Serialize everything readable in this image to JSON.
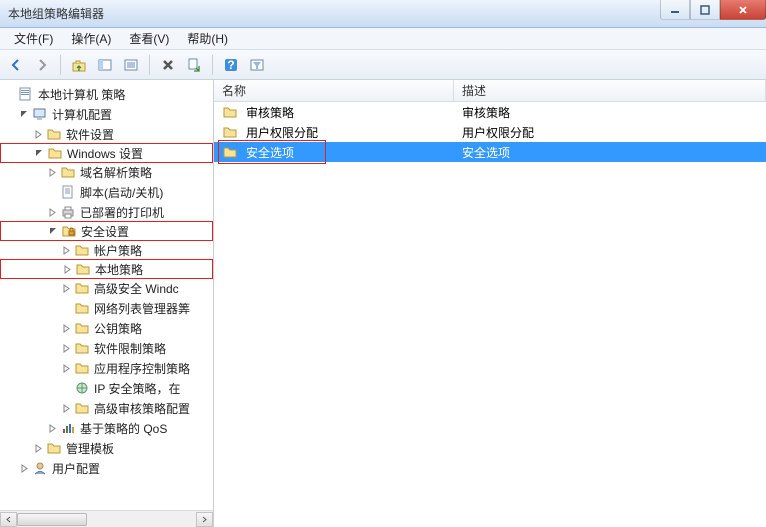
{
  "window": {
    "title": "本地组策略编辑器"
  },
  "menu": {
    "file": "文件(F)",
    "action": "操作(A)",
    "view": "查看(V)",
    "help": "帮助(H)"
  },
  "tree": {
    "root": "本地计算机 策略",
    "computer_config": "计算机配置",
    "software_settings": "软件设置",
    "windows_settings": "Windows 设置",
    "name_resolution": "域名解析策略",
    "scripts": "脚本(启动/关机)",
    "deployed_printers": "已部署的打印机",
    "security_settings": "安全设置",
    "account_policies": "帐户策略",
    "local_policies": "本地策略",
    "adv_security": "高级安全 Windc",
    "network_list": "网络列表管理器筭",
    "public_key": "公钥策略",
    "software_restriction": "软件限制策略",
    "app_control": "应用程序控制策略",
    "ip_security": "IP 安全策略，在",
    "adv_audit": "高级审核策略配置",
    "qos": "基于策略的 QoS",
    "admin_templates": "管理模板",
    "user_config": "用户配置"
  },
  "list": {
    "columns": {
      "name": "名称",
      "description": "描述"
    },
    "rows": [
      {
        "name": "审核策略",
        "description": "审核策略"
      },
      {
        "name": "用户权限分配",
        "description": "用户权限分配"
      },
      {
        "name": "安全选项",
        "description": "安全选项"
      }
    ]
  }
}
